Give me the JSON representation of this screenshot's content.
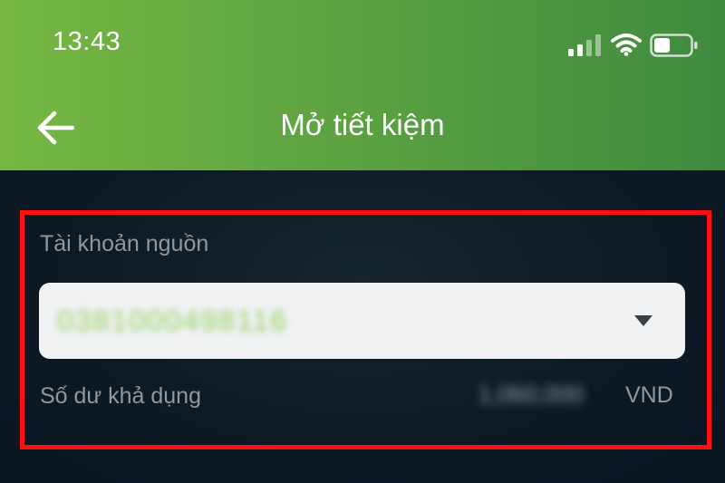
{
  "status_bar": {
    "time": "13:43",
    "signal_icon": "cellular-signal-icon",
    "wifi_icon": "wifi-icon",
    "battery_icon": "battery-icon",
    "battery_level": 0.45
  },
  "header": {
    "title": "Mở tiết kiệm",
    "back_icon": "arrow-left-icon",
    "gradient_start": "#76b843",
    "gradient_end": "#3f8a3f"
  },
  "source_account": {
    "label": "Tài khoản nguồn",
    "value": "0381000498116",
    "dropdown_icon": "caret-down-icon",
    "highlight_color": "#ff1010"
  },
  "balance": {
    "label": "Số dư khả dụng",
    "amount": "1,060,000",
    "currency": "VND"
  }
}
